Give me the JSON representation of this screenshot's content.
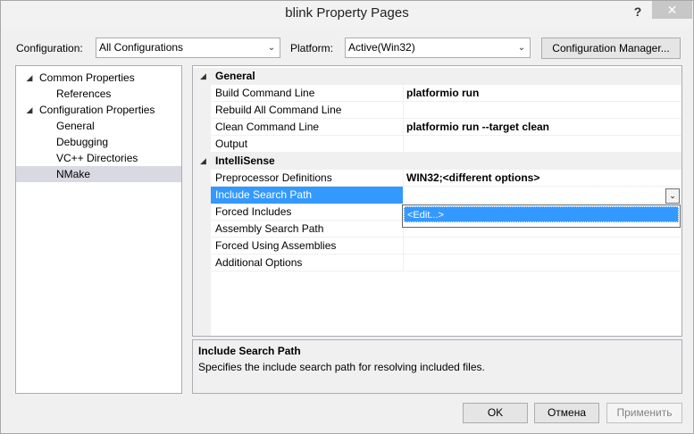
{
  "window": {
    "title": "blink Property Pages",
    "help_glyph": "?",
    "close_glyph": "✕"
  },
  "config_row": {
    "configuration_label": "Configuration:",
    "configuration_value": "All Configurations",
    "platform_label": "Platform:",
    "platform_value": "Active(Win32)",
    "manager_button": "Configuration Manager..."
  },
  "tree": {
    "items": [
      {
        "label": "Common Properties",
        "expanded": true,
        "level": 0
      },
      {
        "label": "References",
        "level": 1
      },
      {
        "label": "Configuration Properties",
        "expanded": true,
        "level": 0
      },
      {
        "label": "General",
        "level": 1
      },
      {
        "label": "Debugging",
        "level": 1
      },
      {
        "label": "VC++ Directories",
        "level": 1
      },
      {
        "label": "NMake",
        "level": 1,
        "selected": true
      }
    ]
  },
  "grid": {
    "categories": [
      {
        "name": "General",
        "properties": [
          {
            "name": "Build Command Line",
            "value": "platformio run"
          },
          {
            "name": "Rebuild All Command Line",
            "value": ""
          },
          {
            "name": "Clean Command Line",
            "value": "platformio run --target clean"
          },
          {
            "name": "Output",
            "value": ""
          }
        ]
      },
      {
        "name": "IntelliSense",
        "properties": [
          {
            "name": "Preprocessor Definitions",
            "value": "WIN32;<different options>"
          },
          {
            "name": "Include Search Path",
            "value": "",
            "selected": true
          },
          {
            "name": "Forced Includes",
            "value": ""
          },
          {
            "name": "Assembly Search Path",
            "value": ""
          },
          {
            "name": "Forced Using Assemblies",
            "value": ""
          },
          {
            "name": "Additional Options",
            "value": ""
          }
        ]
      }
    ],
    "dropdown_item": "<Edit...>"
  },
  "description": {
    "title": "Include Search Path",
    "text": "Specifies the include search path for resolving included files."
  },
  "buttons": {
    "ok": "OK",
    "cancel": "Отмена",
    "apply": "Применить"
  },
  "colors": {
    "selection": "#3399ff",
    "tree_selection": "#d9d9e3"
  },
  "icons": {
    "expanded_triangle": "◢",
    "dropdown_arrow": "⌄"
  }
}
